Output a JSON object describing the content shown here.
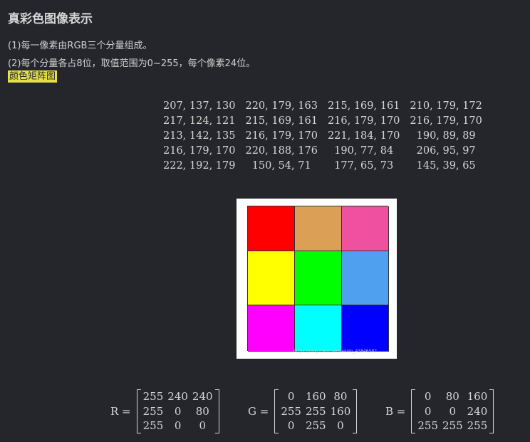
{
  "title": "真彩色图像表示",
  "lines": [
    "(1)每一像素由RGB三个分量组成。",
    "(2)每个分量各占8位，取值范围为0~255，每个像素24位。"
  ],
  "tag_link": "颜色矩阵图",
  "pixel_matrix": [
    [
      "207, 137, 130",
      "220, 179, 163",
      "215, 169, 161",
      "210, 179, 172"
    ],
    [
      "217, 124, 121",
      "215, 169, 161",
      "216, 179, 170",
      "216, 179, 170"
    ],
    [
      "213, 142, 135",
      "216, 179, 170",
      "221, 184, 170",
      "190, 89, 89"
    ],
    [
      "216, 179, 170",
      "220, 188, 176",
      "190, 77, 84",
      "206, 95, 97"
    ],
    [
      "222, 192, 179",
      "150, 54, 71",
      "177, 65, 73",
      "145, 39, 65"
    ]
  ],
  "color_grid": [
    [
      "#ff0000",
      "#dba055",
      "#f050a0"
    ],
    [
      "#ffff00",
      "#00ff00",
      "#50a0f0"
    ],
    [
      "#ff00ff",
      "#00ffff",
      "#0000ff"
    ]
  ],
  "watermark": "https://blog.csdn.net/weixin_43846582",
  "equations": {
    "R": {
      "label": "R =",
      "rows": [
        [
          "255",
          "240",
          "240"
        ],
        [
          "255",
          "0",
          "80"
        ],
        [
          "255",
          "0",
          "0"
        ]
      ]
    },
    "G": {
      "label": "G =",
      "rows": [
        [
          "0",
          "160",
          "80"
        ],
        [
          "255",
          "255",
          "160"
        ],
        [
          "0",
          "255",
          "0"
        ]
      ]
    },
    "B": {
      "label": "B =",
      "rows": [
        [
          "0",
          "80",
          "160"
        ],
        [
          "0",
          "0",
          "240"
        ],
        [
          "255",
          "255",
          "255"
        ]
      ]
    }
  }
}
